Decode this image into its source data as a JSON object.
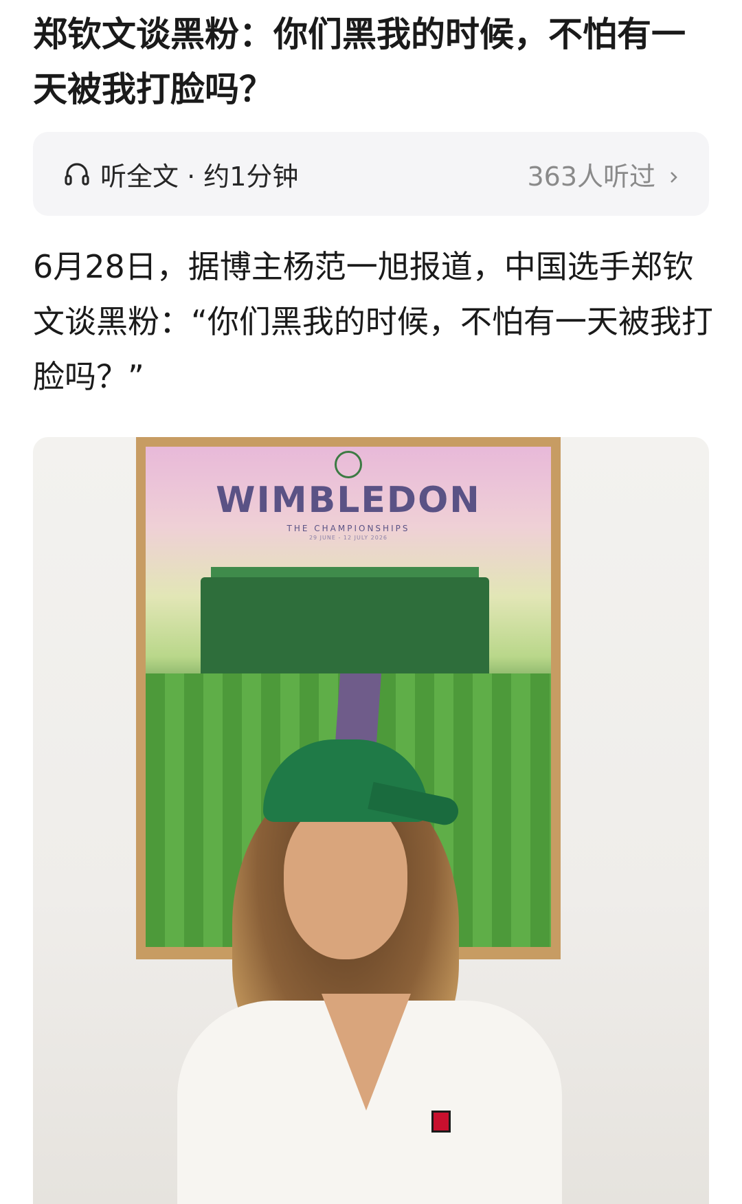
{
  "article": {
    "title": "郑钦文谈黑粉：你们黑我的时候，不怕有一天被我打脸吗？",
    "body": "6月28日，据博主杨范一旭报道，中国选手郑钦文谈黑粉：“你们黑我的时候，不怕有一天被我打脸吗？”"
  },
  "audio": {
    "icon": "headphones-icon",
    "label": "听全文 · 约1分钟",
    "listeners": "363人听过"
  },
  "photo": {
    "poster_title": "WIMBLEDON",
    "poster_subtitle": "THE CHAMPIONSHIPS",
    "poster_dates": "29 JUNE - 12 JULY 2026"
  }
}
